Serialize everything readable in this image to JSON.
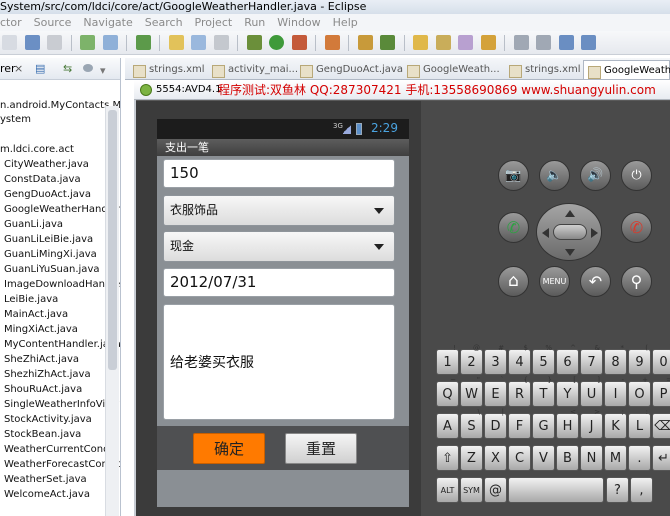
{
  "window": {
    "title": "System/src/com/ldci/core/act/GoogleWeatherHandler.java - Eclipse"
  },
  "menu": [
    "ctor",
    "Source",
    "Navigate",
    "Search",
    "Project",
    "Run",
    "Window",
    "Help"
  ],
  "explorer": {
    "title": "rer",
    "close": "×",
    "project": "n.android.MyContacts.M",
    "system_label": "ystem",
    "package": "m.ldci.core.act",
    "files": [
      "CityWeather.java",
      "ConstData.java",
      "GengDuoAct.java",
      "GoogleWeatherHandler",
      "GuanLi.java",
      "GuanLiLeiBie.java",
      "GuanLiMingXi.java",
      "GuanLiYuSuan.java",
      "ImageDownloadHandle",
      "LeiBie.java",
      "MainAct.java",
      "MingXiAct.java",
      "MyContentHandler.java",
      "SheZhiAct.java",
      "ShezhiZhAct.java",
      "ShouRuAct.java",
      "SingleWeatherInfoView",
      "StockActivity.java",
      "StockBean.java",
      "WeatherCurrentConditi",
      "WeatherForecastCondit",
      "WeatherSet.java",
      "WelcomeAct.java"
    ]
  },
  "editor_tabs": [
    "strings.xml",
    "activity_mai...",
    "GengDuoAct.java",
    "GoogleWeath...",
    "strings.xml",
    "GoogleWeath..."
  ],
  "emulator": {
    "name": "5554:AVD4.1",
    "watermark": "程序测试:双鱼林 QQ:287307421 手机:13558690869 www.shuangyulin.com",
    "status": {
      "signal": "3G",
      "time": "2:29"
    },
    "app_title": "支出一笔",
    "form": {
      "amount": "150",
      "category": "衣服饰品",
      "account": "现金",
      "date": "2012/07/31",
      "note": "给老婆买衣服"
    },
    "buttons": {
      "ok": "确定",
      "reset": "重置"
    },
    "hw_buttons": {
      "camera": "📷",
      "vol_down": "🔈",
      "vol_up": "🔊",
      "power": "⏻",
      "call": "✆",
      "end": "✆",
      "home": "⌂",
      "menu": "MENU",
      "back": "↶",
      "search": "⚲"
    },
    "keyboard": {
      "row1": [
        [
          "1",
          "!"
        ],
        [
          "2",
          "@"
        ],
        [
          "3",
          "#"
        ],
        [
          "4",
          "$"
        ],
        [
          "5",
          "%"
        ],
        [
          "6",
          "^"
        ],
        [
          "7",
          "&"
        ],
        [
          "8",
          "*"
        ],
        [
          "9",
          "("
        ],
        [
          "0",
          ")"
        ]
      ],
      "row2": [
        [
          "Q",
          "~"
        ],
        [
          "W",
          "\""
        ],
        [
          "E",
          "`"
        ],
        [
          "R",
          "{"
        ],
        [
          "T",
          "}"
        ],
        [
          "Y",
          "["
        ],
        [
          "U",
          "]"
        ],
        [
          "I",
          "-"
        ],
        [
          "O",
          "+"
        ],
        [
          "P",
          "="
        ]
      ],
      "row3": [
        [
          "A",
          ""
        ],
        [
          "S",
          "\\"
        ],
        [
          "D",
          "|"
        ],
        [
          "F",
          ""
        ],
        [
          "G",
          ""
        ],
        [
          "H",
          "<"
        ],
        [
          "J",
          ">"
        ],
        [
          "K",
          ";"
        ],
        [
          "L",
          ":"
        ],
        [
          "⌫",
          ""
        ]
      ],
      "row4": [
        [
          "⇧",
          ""
        ],
        [
          "Z",
          ""
        ],
        [
          "X",
          ""
        ],
        [
          "C",
          ""
        ],
        [
          "V",
          ""
        ],
        [
          "B",
          ""
        ],
        [
          "N",
          ""
        ],
        [
          "M",
          ""
        ],
        [
          ".",
          ""
        ],
        [
          "↵",
          ""
        ]
      ],
      "row5": [
        [
          "ALT",
          ""
        ],
        [
          "SYM",
          ""
        ],
        [
          "@",
          ""
        ],
        [
          "",
          ""
        ],
        [
          "?",
          ""
        ],
        [
          ",",
          ""
        ]
      ]
    }
  }
}
